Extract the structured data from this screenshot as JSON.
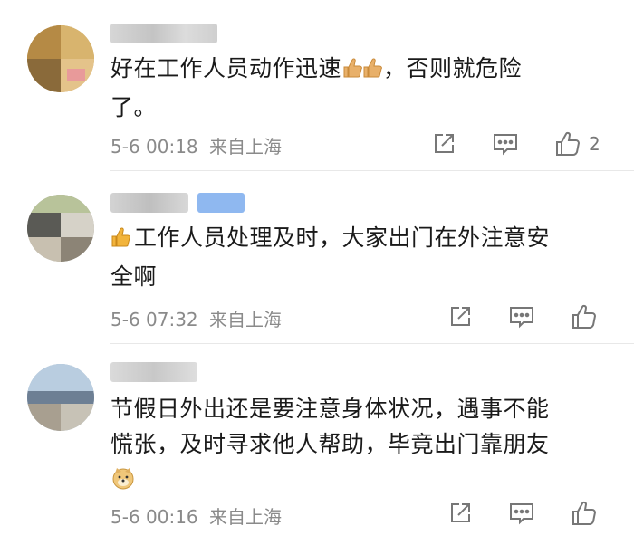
{
  "comments": [
    {
      "text_line1": "好在工作人员动作迅速",
      "text_line1_after": "，否则就危险",
      "text_line2": "了。",
      "time": "5-6 00:18",
      "location": "来自上海",
      "like_count": "2"
    },
    {
      "text_line1": "工作人员处理及时，大家出门在外注意安",
      "text_line2": "全啊",
      "time": "5-6 07:32",
      "location": "来自上海"
    },
    {
      "text_line1": "节假日外出还是要注意身体状况，遇事不能",
      "text_line2": "慌张，及时寻求他人帮助，毕竟出门靠朋友",
      "time": "5-6 00:16",
      "location": "来自上海"
    }
  ],
  "colors": {
    "text": "#1a1a1a",
    "meta": "#8a8a8a",
    "icon": "#777777",
    "divider": "#e8e8e8",
    "badge": "#8fb8f0"
  },
  "icons": {
    "share": "share-icon",
    "comment": "comment-icon",
    "like": "thumbs-up-icon"
  }
}
